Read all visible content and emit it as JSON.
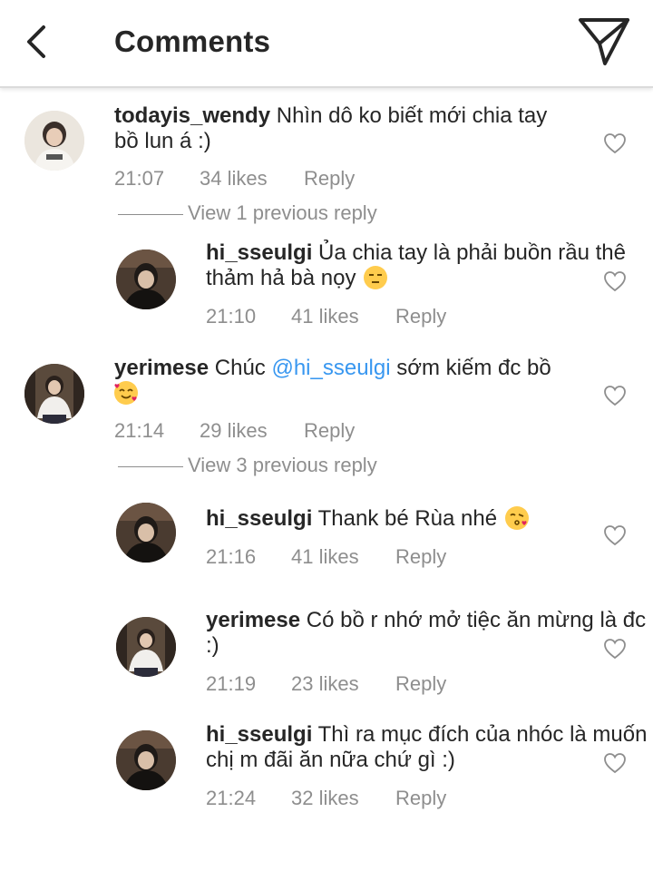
{
  "header": {
    "title": "Comments",
    "back_icon": "chevron-left-icon",
    "send_icon": "paper-plane-icon"
  },
  "comments": [
    {
      "username": "todayis_wendy",
      "text": "Nhìn dô ko biết mới chia tay bồ lun á :)",
      "time": "21:07",
      "likes": "34 likes",
      "reply": "Reply"
    },
    {
      "username": "hi_sseulgi",
      "text": "Ủa chia tay là phải buồn rầu thê thảm hả bà nọy",
      "emoji": "expressionless-face-emoji",
      "time": "21:10",
      "likes": "41 likes",
      "reply": "Reply"
    },
    {
      "username": "yerimese",
      "text_before": "Chúc ",
      "mention": "@hi_sseulgi",
      "text_after": " sớm kiếm đc bồ",
      "emoji": "smiling-face-with-hearts-emoji",
      "time": "21:14",
      "likes": "29 likes",
      "reply": "Reply"
    },
    {
      "username": "hi_sseulgi",
      "text": "Thank bé Rùa nhé",
      "emoji": "face-blowing-kiss-emoji",
      "time": "21:16",
      "likes": "41 likes",
      "reply": "Reply"
    },
    {
      "username": "yerimese",
      "text": "Có bồ r nhớ mở tiệc ăn mừng là đc :)",
      "time": "21:19",
      "likes": "23 likes",
      "reply": "Reply"
    },
    {
      "username": "hi_sseulgi",
      "text": "Thì ra mục đích của nhóc là muốn chị m đãi ăn nữa chứ gì :)",
      "time": "21:24",
      "likes": "32 likes",
      "reply": "Reply"
    }
  ],
  "view_replies": [
    {
      "label": "View 1 previous reply"
    },
    {
      "label": "View 3 previous reply"
    }
  ],
  "colors": {
    "text": "#262626",
    "meta": "#8e8e8e",
    "mention": "#3897f0",
    "divider": "#dbdbdb"
  }
}
